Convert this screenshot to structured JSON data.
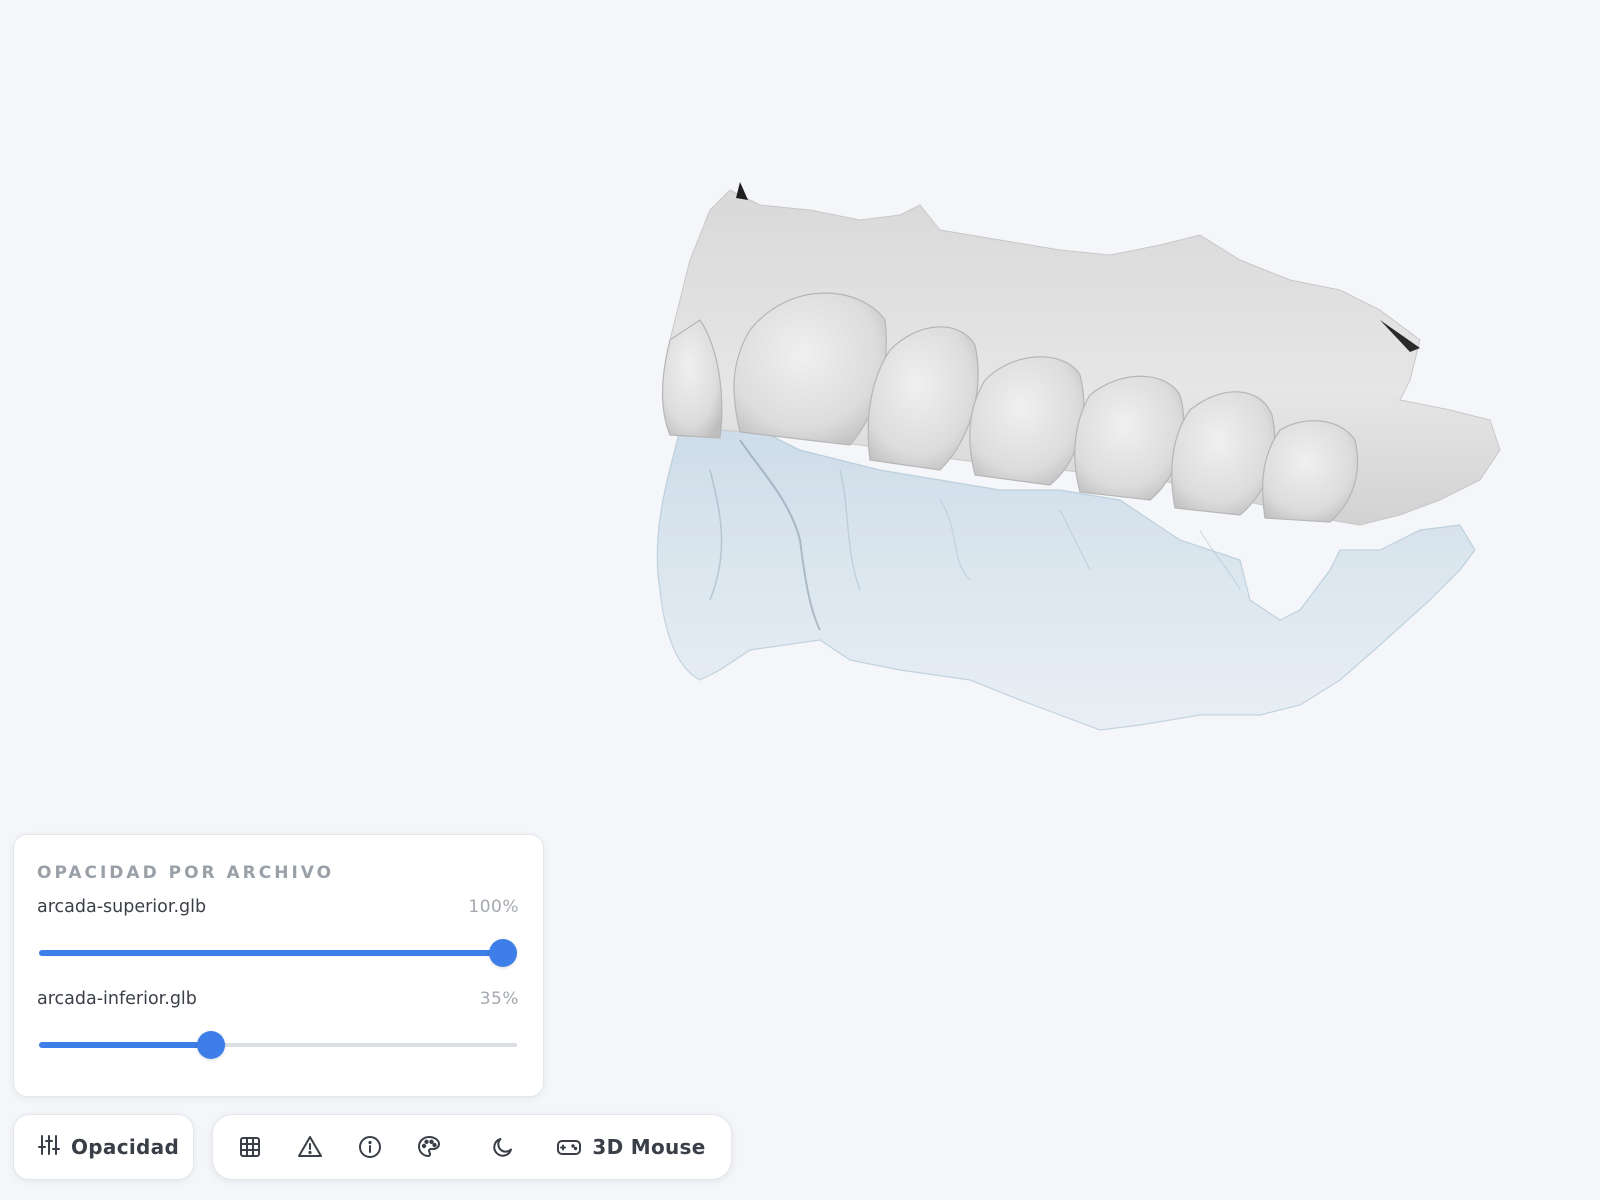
{
  "panel": {
    "title": "OPACIDAD POR ARCHIVO",
    "files": [
      {
        "name": "arcada-superior.glb",
        "percent_label": "100%",
        "value": 1.0
      },
      {
        "name": "arcada-inferior.glb",
        "percent_label": "35%",
        "value": 0.35
      }
    ]
  },
  "toolbar": {
    "opacity_button_label": "Opacidad",
    "opacity_button_icon": "sliders-icon",
    "buttons": [
      {
        "icon": "grid-icon"
      },
      {
        "icon": "warning-icon"
      },
      {
        "icon": "info-icon"
      },
      {
        "icon": "palette-icon"
      },
      {
        "icon": "moon-icon"
      },
      {
        "icon": "gamepad-icon",
        "label": "3D Mouse"
      }
    ]
  },
  "colors": {
    "accent": "#3d7ee8",
    "background": "#f4f6f9",
    "upper_arch": "#e8e8e8",
    "lower_arch": "#c9dbe8"
  }
}
